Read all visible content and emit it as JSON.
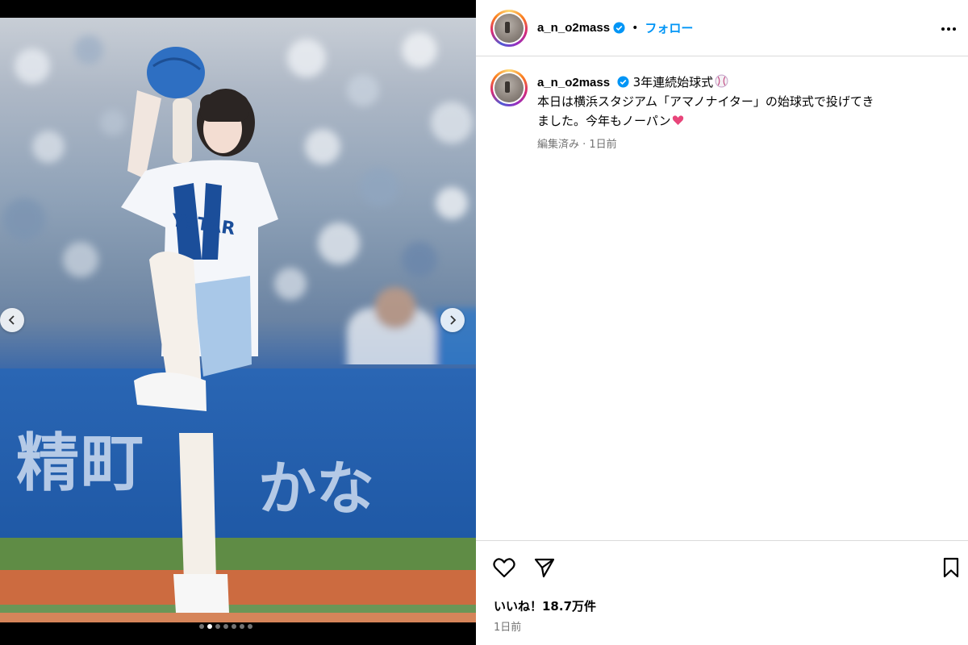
{
  "post": {
    "username": "a_n_o2mass",
    "follow_label": "フォロー",
    "caption_title": "3年連続始球式",
    "caption_line2": "本日は横浜スタジアム「アマノナイター」の始球式で投げてき",
    "caption_line3": "ました。今年もノーパン",
    "edited_meta": "編集済み · 1日前",
    "likes_text": "いいね！18.7万件",
    "time_text": "1日前"
  },
  "carousel": {
    "dot_count": 7,
    "active_index": 1
  },
  "colors": {
    "follow": "#0095f6",
    "verified": "#0095f6"
  },
  "icons": {
    "more": "more-options-icon",
    "like": "heart-icon",
    "share": "send-icon",
    "save": "bookmark-icon",
    "prev": "chevron-left-icon",
    "next": "chevron-right-icon"
  }
}
